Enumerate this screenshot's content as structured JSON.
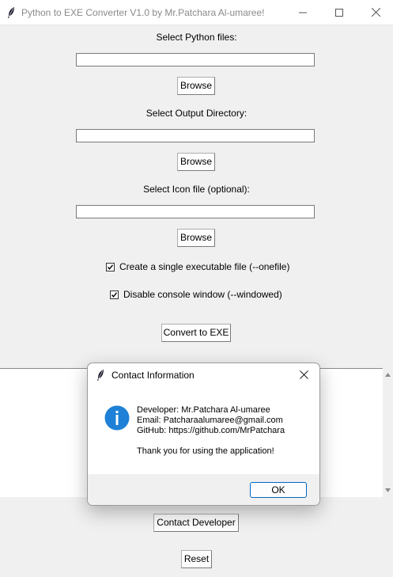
{
  "window": {
    "title": "Python to EXE Converter V1.0 by Mr.Patchara Al-umaree!"
  },
  "form": {
    "python_label": "Select Python files:",
    "python_value": "",
    "output_label": "Select Output Directory:",
    "output_value": "",
    "icon_label": "Select Icon file (optional):",
    "icon_value": "",
    "browse_label": "Browse",
    "onefile_label": "Create a single executable file (--onefile)",
    "onefile_checked": true,
    "windowed_label": "Disable console window (--windowed)",
    "windowed_checked": true,
    "convert_label": "Convert to EXE",
    "contact_label": "Contact Developer",
    "reset_label": "Reset"
  },
  "dialog": {
    "title": "Contact Information",
    "lines": [
      "Developer: Mr.Patchara Al-umaree",
      "Email: Patcharaalumaree@gmail.com",
      "GitHub: https://github.com/MrPatchara"
    ],
    "thanks": "Thank you for using the application!",
    "ok_label": "OK"
  },
  "colors": {
    "info_blue": "#1e80d6",
    "ok_border": "#0067c0",
    "background": "#f0f0f0"
  },
  "icons": {
    "app": "feather-icon",
    "info": "info-icon"
  }
}
